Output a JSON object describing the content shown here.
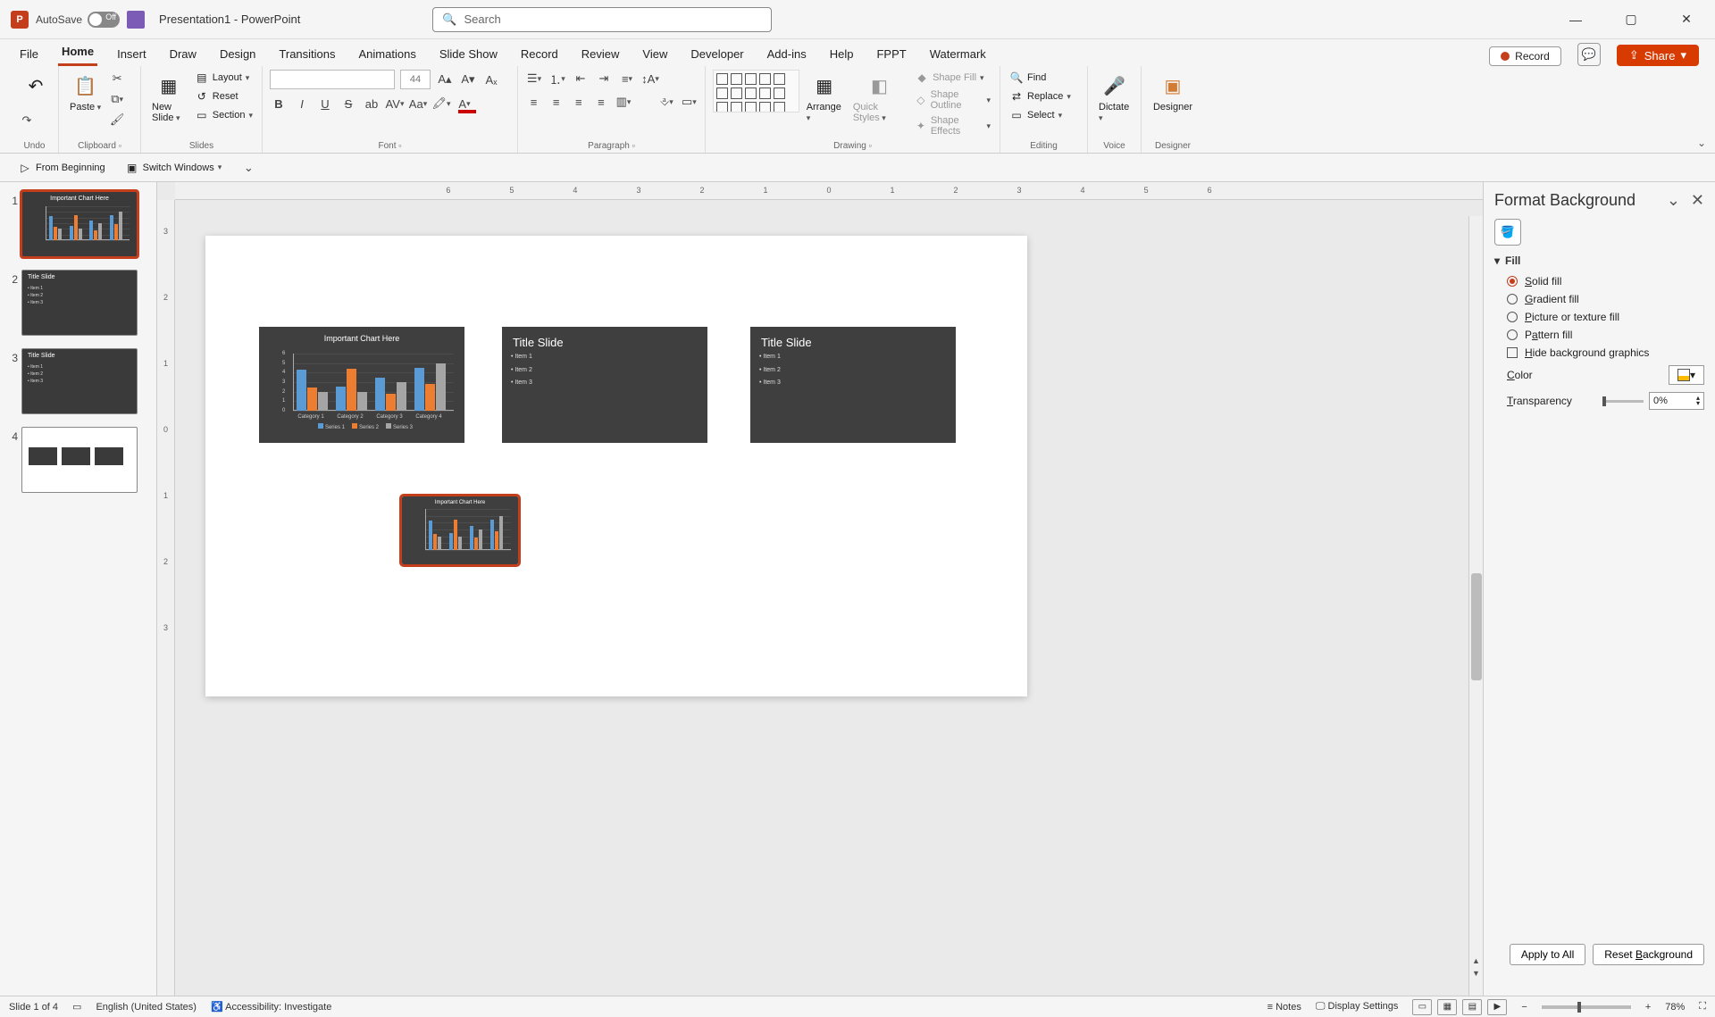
{
  "titlebar": {
    "autosave_label": "AutoSave",
    "autosave_state": "Off",
    "doc_title": "Presentation1 - PowerPoint",
    "search_placeholder": "Search"
  },
  "tabs": {
    "items": [
      "File",
      "Home",
      "Insert",
      "Draw",
      "Design",
      "Transitions",
      "Animations",
      "Slide Show",
      "Record",
      "Review",
      "View",
      "Developer",
      "Add-ins",
      "Help",
      "FPPT",
      "Watermark"
    ],
    "active": "Home",
    "record_label": "Record",
    "share_label": "Share"
  },
  "ribbon": {
    "undo_group": "Undo",
    "clipboard": {
      "paste": "Paste",
      "cut": "Cut",
      "copy": "Copy",
      "format_painter": "Format Painter",
      "group": "Clipboard"
    },
    "slides": {
      "new_slide": "New Slide",
      "layout": "Layout",
      "reset": "Reset",
      "section": "Section",
      "group": "Slides"
    },
    "font": {
      "size_placeholder": "44",
      "group": "Font"
    },
    "paragraph": {
      "group": "Paragraph"
    },
    "drawing": {
      "arrange": "Arrange",
      "quick_styles": "Quick Styles",
      "shape_fill": "Shape Fill",
      "shape_outline": "Shape Outline",
      "shape_effects": "Shape Effects",
      "group": "Drawing"
    },
    "editing": {
      "find": "Find",
      "replace": "Replace",
      "select": "Select",
      "group": "Editing"
    },
    "voice": {
      "dictate": "Dictate",
      "group": "Voice"
    },
    "designer": {
      "label": "Designer",
      "group": "Designer"
    }
  },
  "qat": {
    "from_beginning": "From Beginning",
    "switch_windows": "Switch Windows"
  },
  "ruler": {
    "h": [
      "6",
      "5",
      "4",
      "3",
      "2",
      "1",
      "0",
      "1",
      "2",
      "3",
      "4",
      "5",
      "6"
    ],
    "v": [
      "3",
      "2",
      "1",
      "0",
      "1",
      "2",
      "3"
    ]
  },
  "thumbs": {
    "slide1_title": "Important Chart Here",
    "slide2_title": "Title Slide",
    "slide3_title": "Title Slide",
    "bullets": [
      "• Item 1",
      "• Item 2",
      "• Item 3"
    ]
  },
  "canvas": {
    "mini1_title": "Important Chart Here",
    "mini2_title": "Title Slide",
    "mini3_title": "Title Slide",
    "bullets": [
      "• Item 1",
      "• Item 2",
      "• Item 3"
    ],
    "drag_title": "Important Chart Here"
  },
  "chart_data": {
    "type": "bar",
    "title": "Important Chart Here",
    "categories": [
      "Category 1",
      "Category 2",
      "Category 3",
      "Category 4"
    ],
    "series": [
      {
        "name": "Series 1",
        "values": [
          4.3,
          2.5,
          3.5,
          4.5
        ]
      },
      {
        "name": "Series 2",
        "values": [
          2.4,
          4.4,
          1.8,
          2.8
        ]
      },
      {
        "name": "Series 3",
        "values": [
          2.0,
          2.0,
          3.0,
          5.0
        ]
      }
    ],
    "yticks": [
      0,
      1,
      2,
      3,
      4,
      5,
      6
    ],
    "ylim": [
      0,
      6
    ],
    "xlabel": "",
    "ylabel": ""
  },
  "pane": {
    "title": "Format Background",
    "section_fill": "Fill",
    "solid": "Solid fill",
    "gradient": "Gradient fill",
    "picture": "Picture or texture fill",
    "pattern": "Pattern fill",
    "hide_bg": "Hide background graphics",
    "color_label": "Color",
    "transparency_label": "Transparency",
    "transparency_value": "0%",
    "apply_all": "Apply to All",
    "reset_bg": "Reset Background"
  },
  "statusbar": {
    "slide_counter": "Slide 1 of 4",
    "language": "English (United States)",
    "accessibility": "Accessibility: Investigate",
    "notes": "Notes",
    "display_settings": "Display Settings",
    "zoom": "78%"
  }
}
